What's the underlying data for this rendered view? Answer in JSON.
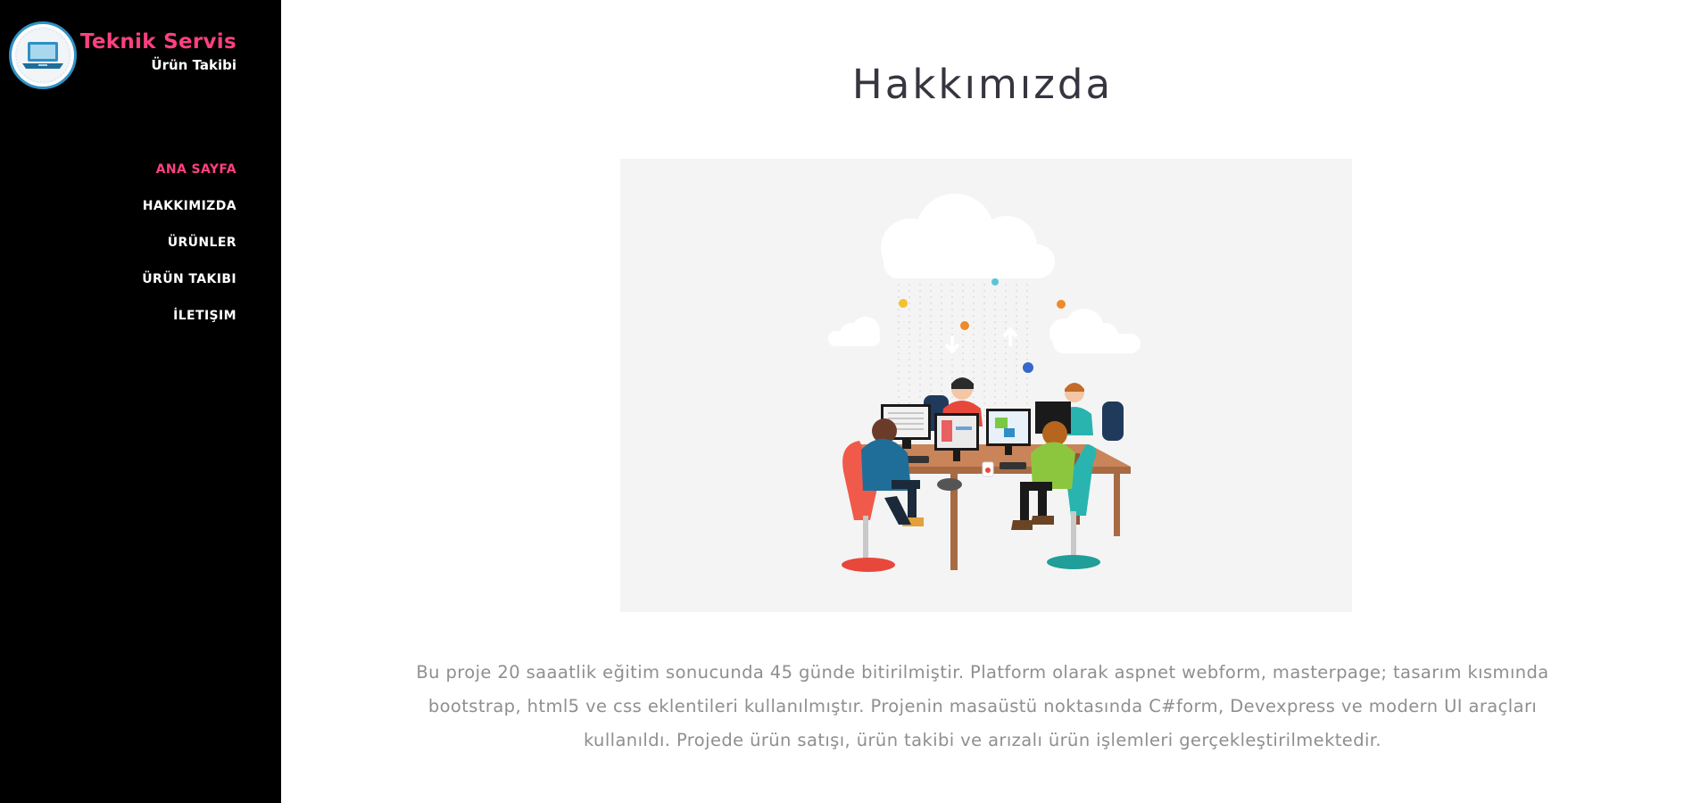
{
  "brand": {
    "title": "Teknik Servis",
    "subtitle": "Ürün Takibi",
    "logo_icon": "laptop-icon"
  },
  "nav": {
    "items": [
      {
        "label": "ANA SAYFA",
        "active": true
      },
      {
        "label": "HAKKIMIZDA",
        "active": false
      },
      {
        "label": "ÜRÜNLER",
        "active": false
      },
      {
        "label": "ÜRÜN TAKIBI",
        "active": false
      },
      {
        "label": "İLETIŞIM",
        "active": false
      }
    ]
  },
  "main": {
    "title": "Hakkımızda",
    "hero_icon": "team-working-illustration",
    "paragraph": "Bu proje 20 saaatlik eğitim sonucunda 45 günde bitirilmiştir. Platform olarak aspnet webform, masterpage; tasarım kısmında bootstrap, html5 ve css eklentileri kullanılmıştır. Projenin masaüstü noktasında C#form, Devexpress ve modern UI araçları kullanıldı. Projede ürün satışı, ürün takibi ve arızalı ürün işlemleri gerçekleştirilmektedir."
  },
  "colors": {
    "sidebar_bg": "#000000",
    "accent": "#ff4081",
    "title": "#37353f",
    "body_text": "#8f8f8f",
    "hero_bg": "#f4f4f4"
  }
}
